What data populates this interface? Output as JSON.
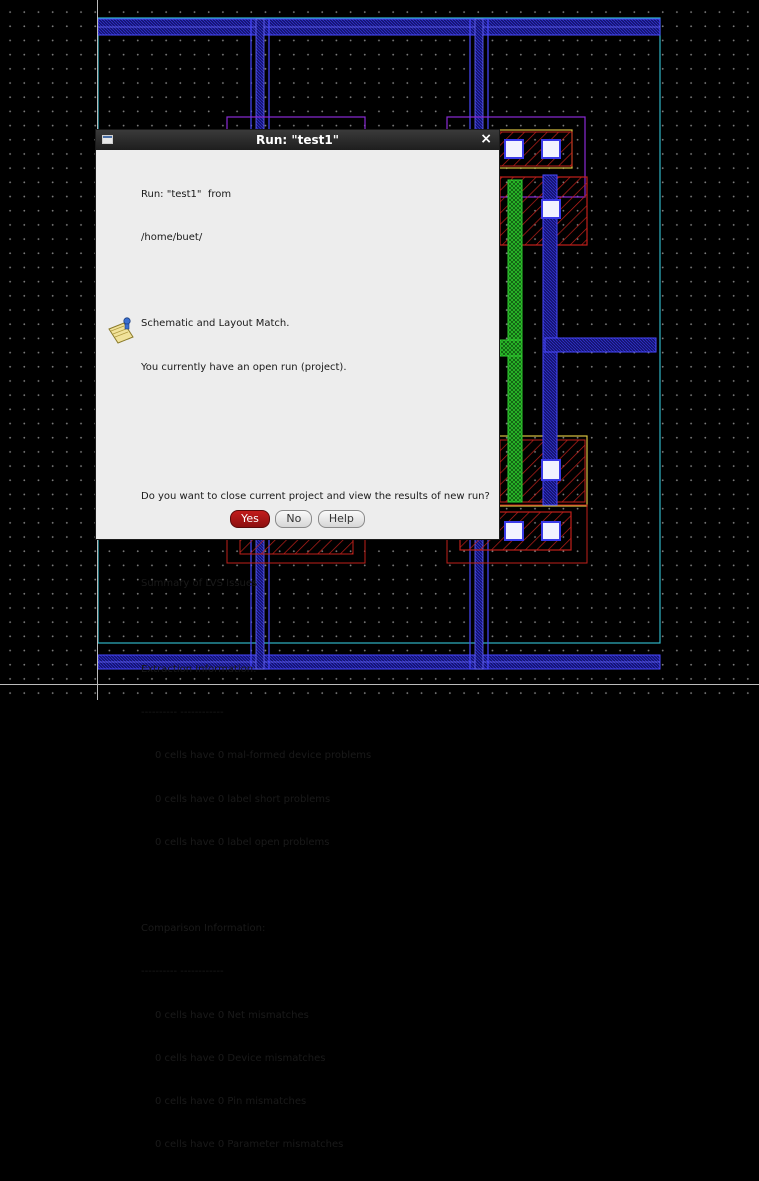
{
  "dialog": {
    "title": "Run: \"test1\"",
    "lines": {
      "run_from": "Run: \"test1\"  from",
      "path": "/home/buet/",
      "blank1": "",
      "match": "Schematic and Layout Match.",
      "open_run": "You currently have an open run (project).",
      "blank2": "",
      "blank3": "",
      "question": "Do you want to close current project and view the results of new run?",
      "blank4": "",
      "summary": "Summary of LVS Issues",
      "blank5": "",
      "extraction": "Extraction Information:",
      "sep1": "---------- ------------",
      "malformed": "0 cells have 0 mal-formed device problems",
      "short": "0 cells have 0 label short problems",
      "open": "0 cells have 0 label open problems",
      "blank6": "",
      "comparison": "Comparison Information:",
      "sep2": "---------- ------------",
      "net": "0 cells have 0 Net mismatches",
      "device": "0 cells have 0 Device mismatches",
      "pin": "0 cells have 0 Pin mismatches",
      "param": "0 cells have 0 Parameter mismatches"
    },
    "buttons": {
      "yes": "Yes",
      "no": "No",
      "help": "Help"
    }
  },
  "colors": {
    "background": "#000000",
    "dot_grid": "#7a7a7a",
    "cell_boundary": "#2fb5c4",
    "metal1": "#2a2fd6",
    "metal2_outline": "#6b6bff",
    "poly": "#22b022",
    "diffusion": "#c0201a",
    "active_outline": "#d8c040",
    "nwell_outline": "#8a2ad6",
    "contact": "#ffffff",
    "dialog_bg": "#ededed",
    "titlebar": "#2a2a2a",
    "yes_button": "#a81515"
  },
  "icons": {
    "window": "window-icon",
    "close": "close-icon",
    "note": "note-icon"
  }
}
